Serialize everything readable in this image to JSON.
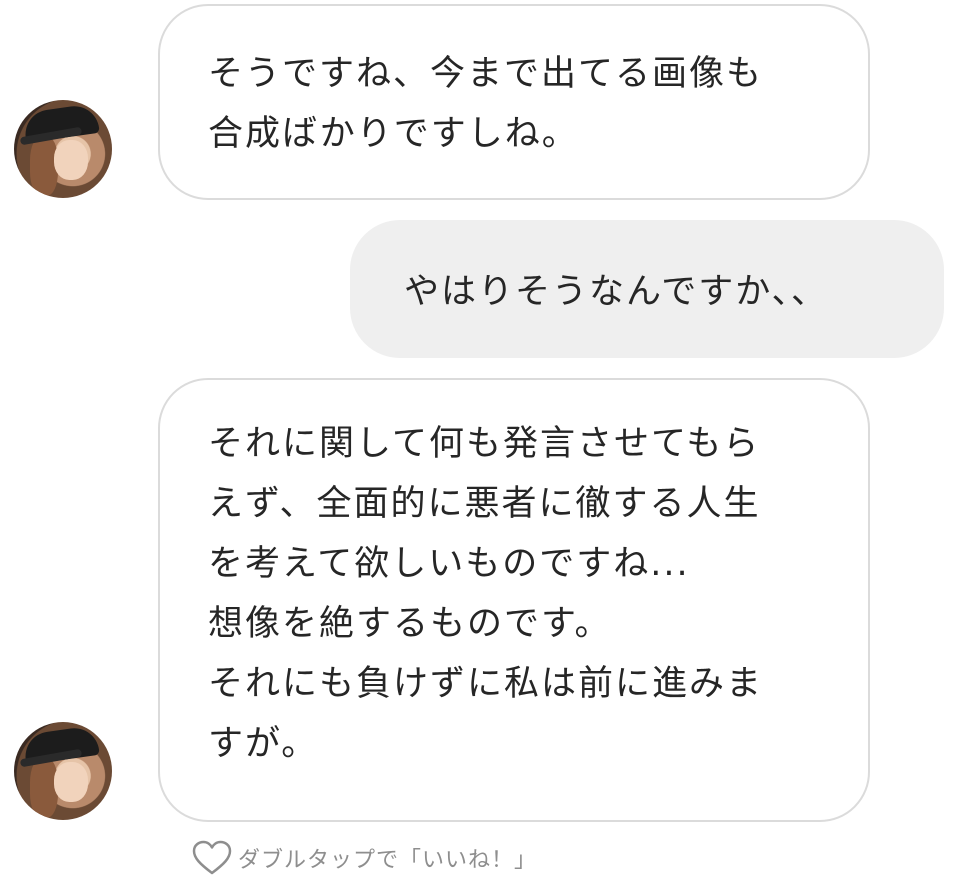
{
  "messages": [
    {
      "direction": "received",
      "lines": [
        "そうですね、今まで出てる画像も",
        "合成ばかりですしね。"
      ]
    },
    {
      "direction": "sent",
      "lines": [
        "やはりそうなんですか、、"
      ]
    },
    {
      "direction": "received",
      "lines": [
        "それに関して何も発言させてもら",
        "えず、全面的に悪者に徹する人生",
        "を考えて欲しいものですね...",
        "想像を絶するものです。",
        "それにも負けずに私は前に進みま",
        "すが。"
      ]
    }
  ],
  "like_hint": {
    "icon": "heart-outline-icon",
    "text": "ダブルタップで「いいね！」"
  },
  "colors": {
    "received_border": "#dbdbdb",
    "sent_background": "#efefef",
    "text": "#262626",
    "hint_text": "#8e8e8e"
  }
}
